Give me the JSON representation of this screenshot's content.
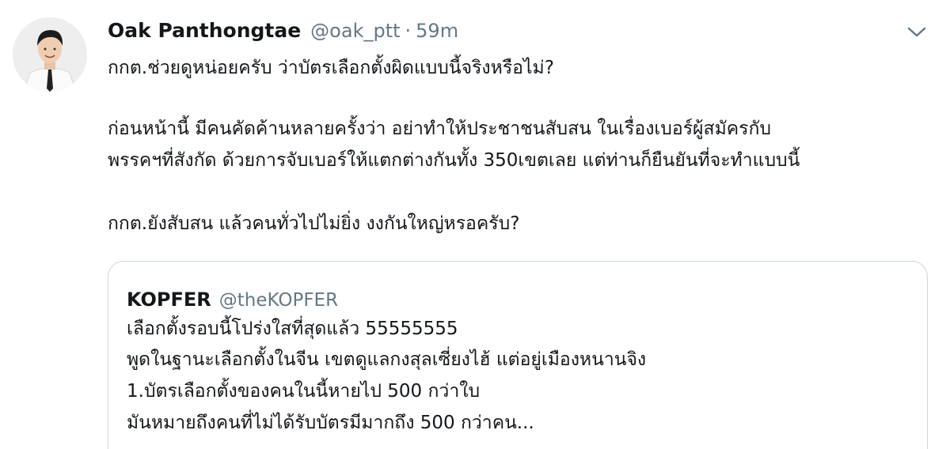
{
  "tweet": {
    "author_name": "Oak Panthongtae",
    "author_handle": "@oak_ptt",
    "separator": "·",
    "time": "59m",
    "menu_icon": "chevron-down-icon",
    "text_lines": [
      "กกต.ช่วยดูหน่อยครับ ว่าบัตรเลือกตั้งผิดแบบนี้จริงหรือไม่?",
      "ก่อนหน้านี้ มีคนคัดค้านหลายครั้งว่า อย่าทำให้ประชาชนสับสน ในเรื่องเบอร์ผู้สมัครกับ",
      "พรรคฯที่สังกัด ด้วยการจับเบอร์ให้แตกต่างกันทั้ง 350เขตเลย แต่ท่านก็ยืนยันที่จะทำแบบนี้",
      "กกต.ยังสับสน แล้วคนทั่วไปไม่ยิ่ง งงกันใหญ่หรอครับ?"
    ],
    "quoted": {
      "author_name": "KOPFER",
      "author_handle": "@theKOPFER",
      "text_lines": [
        "เลือกตั้งรอบนี้โปร่งใสที่สุดแล้ว 55555555",
        "พูดในฐานะเลือกตั้งในจีน เขตดูแลกงสุลเซี่ยงไฮ้ แต่อยู่เมืองหนานจิง",
        "1.บัตรเลือกตั้งของคนในนี้หายไป 500 กว่าใบ",
        "มันหมายถึงคนที่ไม่ได้รับบัตรมีมากถึง 500 กว่าคน..."
      ]
    }
  }
}
